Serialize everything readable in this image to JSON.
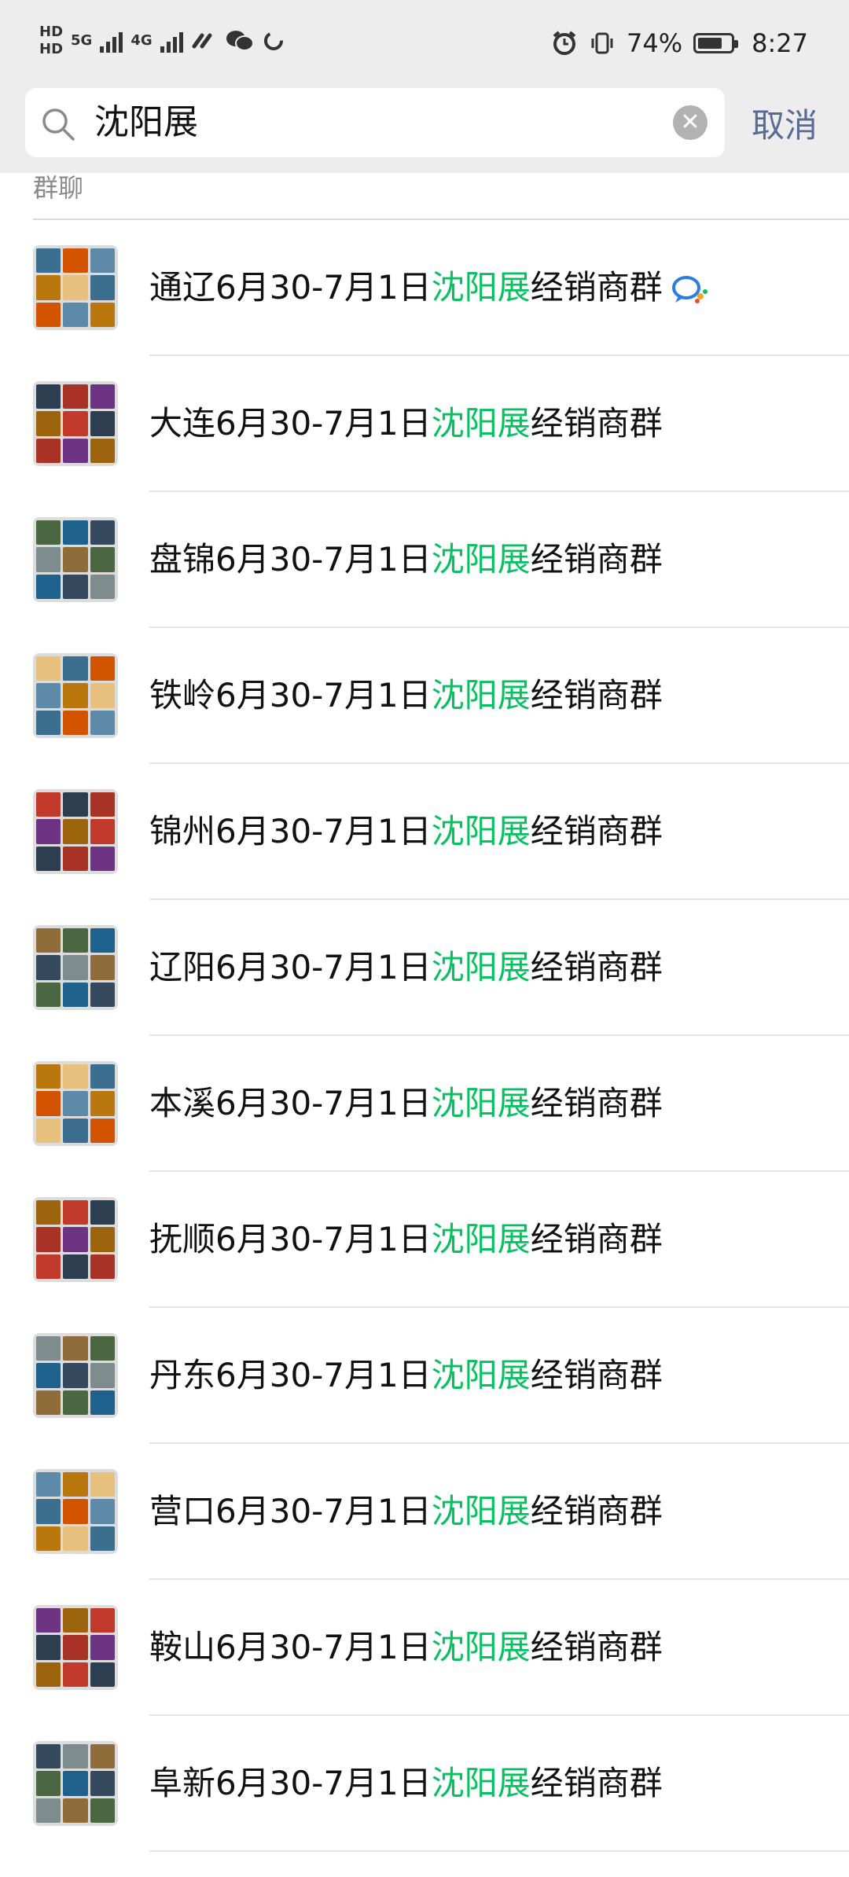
{
  "status_bar": {
    "hd_top": "HD",
    "hd_bottom": "HD",
    "net1": "5G",
    "net2": "4G",
    "battery_percent": "74%",
    "battery_level": 0.74,
    "time": "8:27"
  },
  "search": {
    "query": "沈阳展",
    "cancel_label": "取消"
  },
  "section_label": "群聊",
  "results": [
    {
      "prefix": "通辽6月30-7月1日",
      "highlight": "沈阳展",
      "suffix": "经销商群",
      "has_badge": true
    },
    {
      "prefix": "大连6月30-7月1日",
      "highlight": "沈阳展",
      "suffix": "经销商群"
    },
    {
      "prefix": "盘锦6月30-7月1日",
      "highlight": "沈阳展",
      "suffix": "经销商群"
    },
    {
      "prefix": "铁岭6月30-7月1日",
      "highlight": "沈阳展",
      "suffix": "经销商群"
    },
    {
      "prefix": "锦州6月30-7月1日",
      "highlight": "沈阳展",
      "suffix": "经销商群"
    },
    {
      "prefix": "辽阳6月30-7月1日",
      "highlight": "沈阳展",
      "suffix": "经销商群"
    },
    {
      "prefix": "本溪6月30-7月1日",
      "highlight": "沈阳展",
      "suffix": "经销商群"
    },
    {
      "prefix": "抚顺6月30-7月1日",
      "highlight": "沈阳展",
      "suffix": "经销商群"
    },
    {
      "prefix": "丹东6月30-7月1日",
      "highlight": "沈阳展",
      "suffix": "经销商群"
    },
    {
      "prefix": "营口6月30-7月1日",
      "highlight": "沈阳展",
      "suffix": "经销商群"
    },
    {
      "prefix": "鞍山6月30-7月1日",
      "highlight": "沈阳展",
      "suffix": "经销商群"
    },
    {
      "prefix": "阜新6月30-7月1日",
      "highlight": "沈阳展",
      "suffix": "经销商群"
    }
  ],
  "colors": {
    "highlight": "#07c160",
    "cancel": "#576b95",
    "header_bg": "#ededed"
  },
  "icons": {
    "search": "search-icon",
    "clear": "clear-icon",
    "chat_badge": "enterprise-chat-icon"
  }
}
